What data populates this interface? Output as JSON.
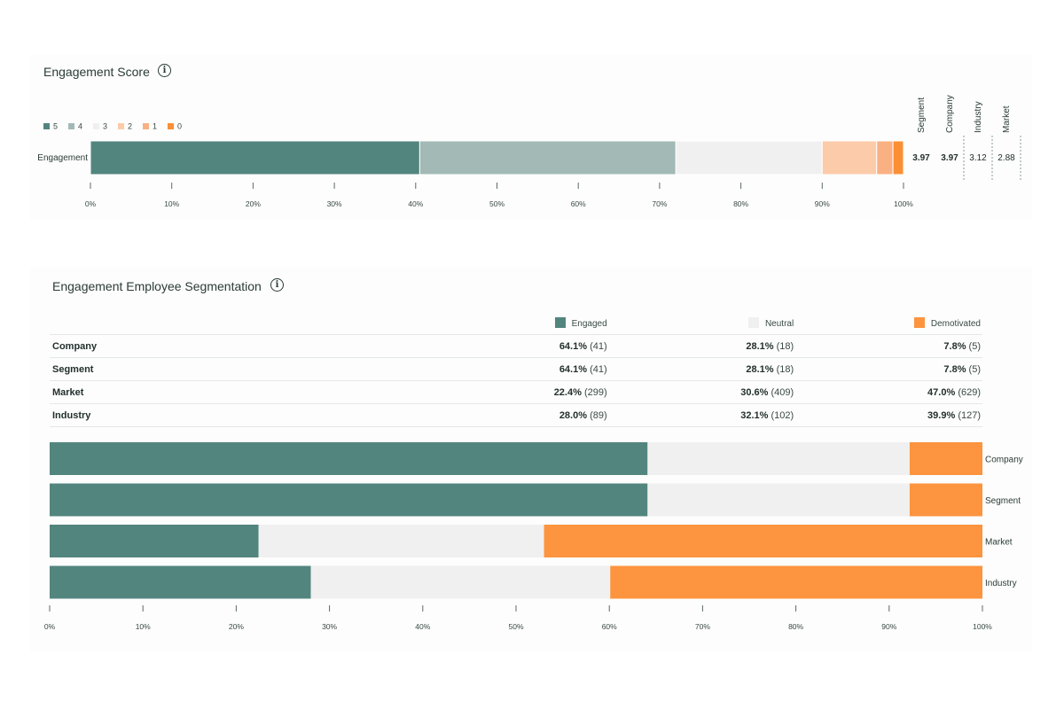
{
  "colors": {
    "score_5": "#53857f",
    "score_4": "#a2b9b5",
    "score_3": "#f0f0f0",
    "score_2": "#fccbaa",
    "score_1": "#f9b183",
    "score_0": "#fb8f35",
    "engaged": "#53857f",
    "neutral": "#f0f0f0",
    "demotivated": "#fd943f"
  },
  "engagement_score": {
    "title": "Engagement Score",
    "info_icon": "info-icon",
    "legend": [
      "5",
      "4",
      "3",
      "2",
      "1",
      "0"
    ],
    "comparison_headers": [
      "Segment",
      "Company",
      "Industry",
      "Market"
    ],
    "comparison_values": [
      "3.97",
      "3.97",
      "3.12",
      "2.88"
    ]
  },
  "segmentation": {
    "title": "Engagement Employee Segmentation",
    "info_icon": "info-icon",
    "legend": [
      "Engaged",
      "Neutral",
      "Demotivated"
    ],
    "rows": [
      {
        "label": "Company",
        "engaged_pct": "64.1%",
        "engaged_n": "(41)",
        "neutral_pct": "28.1%",
        "neutral_n": "(18)",
        "demotivated_pct": "7.8%",
        "demotivated_n": "(5)"
      },
      {
        "label": "Segment",
        "engaged_pct": "64.1%",
        "engaged_n": "(41)",
        "neutral_pct": "28.1%",
        "neutral_n": "(18)",
        "demotivated_pct": "7.8%",
        "demotivated_n": "(5)"
      },
      {
        "label": "Market",
        "engaged_pct": "22.4%",
        "engaged_n": "(299)",
        "neutral_pct": "30.6%",
        "neutral_n": "(409)",
        "demotivated_pct": "47.0%",
        "demotivated_n": "(629)"
      },
      {
        "label": "Industry",
        "engaged_pct": "28.0%",
        "engaged_n": "(89)",
        "neutral_pct": "32.1%",
        "neutral_n": "(102)",
        "demotivated_pct": "39.9%",
        "demotivated_n": "(127)"
      }
    ]
  },
  "chart_data": [
    {
      "type": "bar",
      "orientation": "horizontal",
      "stacked": true,
      "title": "Engagement Score",
      "categories": [
        "Engagement"
      ],
      "series": [
        {
          "name": "5",
          "values": [
            40.5
          ]
        },
        {
          "name": "4",
          "values": [
            31.5
          ]
        },
        {
          "name": "3",
          "values": [
            18.0
          ]
        },
        {
          "name": "2",
          "values": [
            6.7
          ]
        },
        {
          "name": "1",
          "values": [
            2.0
          ]
        },
        {
          "name": "0",
          "values": [
            1.3
          ]
        }
      ],
      "x_ticks": [
        "0%",
        "10%",
        "20%",
        "30%",
        "40%",
        "50%",
        "60%",
        "70%",
        "80%",
        "90%",
        "100%"
      ],
      "xlim": [
        0,
        100
      ],
      "legend_position": "top-left",
      "grid": false
    },
    {
      "type": "bar",
      "orientation": "horizontal",
      "stacked": true,
      "title": "Engagement Employee Segmentation",
      "categories": [
        "Company",
        "Segment",
        "Market",
        "Industry"
      ],
      "series": [
        {
          "name": "Engaged",
          "values": [
            64.1,
            64.1,
            22.4,
            28.0
          ]
        },
        {
          "name": "Neutral",
          "values": [
            28.1,
            28.1,
            30.6,
            32.1
          ]
        },
        {
          "name": "Demotivated",
          "values": [
            7.8,
            7.8,
            47.0,
            39.9
          ]
        }
      ],
      "x_ticks": [
        "0%",
        "10%",
        "20%",
        "30%",
        "40%",
        "50%",
        "60%",
        "70%",
        "80%",
        "90%",
        "100%"
      ],
      "xlim": [
        0,
        100
      ],
      "category_labels_position": "right",
      "grid": false
    }
  ]
}
